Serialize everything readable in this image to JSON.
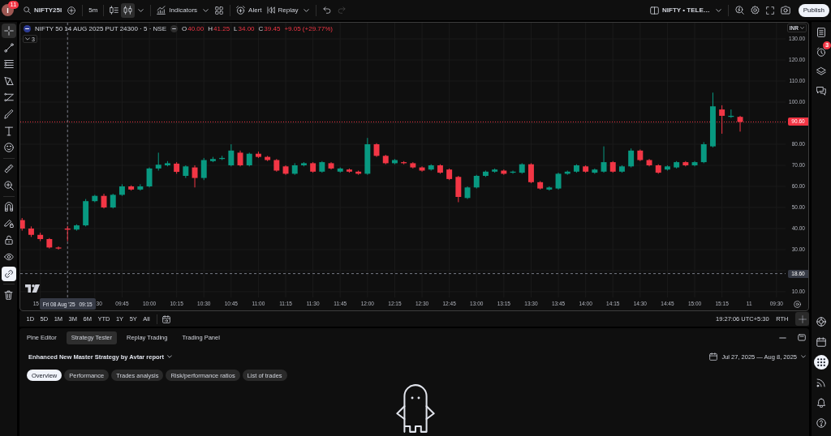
{
  "top_bar": {
    "avatar": {
      "letter": "I",
      "badge": "11"
    },
    "symbol": "NIFTY25I",
    "interval": "5m",
    "chart_styles": [
      {
        "kind": "bars",
        "selected": false
      },
      {
        "kind": "candles",
        "selected": true
      }
    ],
    "indicators": "Indicators",
    "alert": "Alert",
    "replay": "Replay",
    "history": [
      {
        "kind": "undo",
        "disabled": false
      },
      {
        "kind": "redo",
        "disabled": true
      }
    ],
    "layout": "NIFTY • TELE…",
    "publish": "Publish"
  },
  "left_toolbar": {
    "tools": [
      {
        "kind": "crosshair",
        "selected": true
      },
      {
        "kind": "trend-line",
        "selected": false
      },
      {
        "kind": "fib-lines",
        "selected": false
      },
      {
        "kind": "pattern",
        "selected": false
      },
      {
        "kind": "projection",
        "selected": false
      },
      {
        "kind": "brush",
        "selected": false
      },
      {
        "kind": "text",
        "selected": false
      },
      {
        "kind": "emoji",
        "selected": false
      }
    ],
    "measure": [
      {
        "kind": "ruler",
        "selected": false
      },
      {
        "kind": "zoom",
        "selected": false
      }
    ],
    "toggles": [
      {
        "kind": "magnet",
        "on": false
      },
      {
        "kind": "drawing-mode",
        "on": false
      },
      {
        "kind": "lock",
        "on": false
      },
      {
        "kind": "hide",
        "on": false
      },
      {
        "kind": "sync",
        "on": true
      }
    ]
  },
  "chart": {
    "title": "NIFTY 50 14 AUG 2025 PUT 24300 · 5 · NSE",
    "ohlc": [
      {
        "label": "O",
        "value": "40.00"
      },
      {
        "label": "H",
        "value": "41.25"
      },
      {
        "label": "L",
        "value": "34.00"
      },
      {
        "label": "C",
        "value": "39.45"
      }
    ],
    "change": "+9.05 (+29.77%)",
    "falling": true,
    "indicator_count": "3",
    "currency": "INR",
    "crosshair_date": "Fri 08 Aug '25",
    "crosshair_time": "09:15",
    "partial_time_labels": [
      "15",
      "30"
    ],
    "chart_data": {
      "type": "candlestick",
      "grid": true,
      "categories": [
        null,
        null,
        null,
        null,
        null,
        null,
        null,
        null,
        null,
        null,
        null,
        "09:45",
        null,
        null,
        "10:00",
        null,
        null,
        "10:15",
        null,
        null,
        "10:30",
        null,
        null,
        "10:45",
        null,
        null,
        "11:00",
        null,
        null,
        "11:15",
        null,
        null,
        "11:30",
        null,
        null,
        "11:45",
        null,
        null,
        "12:00",
        null,
        null,
        "12:15",
        null,
        null,
        "12:30",
        null,
        null,
        "12:45",
        null,
        null,
        "13:00",
        null,
        null,
        "13:15",
        null,
        null,
        "13:30",
        null,
        null,
        "13:45",
        null,
        null,
        "14:00",
        null,
        null,
        "14:15",
        null,
        null,
        "14:30",
        null,
        null,
        "14:45",
        null,
        null,
        "15:00",
        null,
        null,
        "15:15",
        null,
        null,
        "11",
        null,
        null,
        "09:30"
      ],
      "ohlc": [
        [
          44,
          45,
          39,
          40
        ],
        [
          40,
          41,
          36,
          37
        ],
        [
          37,
          38,
          34,
          35
        ],
        [
          35,
          35.5,
          30.5,
          31
        ],
        [
          31,
          31.5,
          30,
          30.5
        ],
        [
          40,
          41.25,
          34,
          39.45
        ],
        [
          39.5,
          42,
          39,
          41.5
        ],
        [
          41.5,
          54,
          41,
          53
        ],
        [
          53,
          56,
          52.5,
          55.5
        ],
        [
          55.5,
          56.5,
          49.5,
          50
        ],
        [
          50,
          56.5,
          49.5,
          56
        ],
        [
          56,
          61,
          55.5,
          60
        ],
        [
          60,
          60.5,
          58,
          58.5
        ],
        [
          58.5,
          61,
          58,
          60
        ],
        [
          60,
          69,
          59.5,
          68.5
        ],
        [
          68.5,
          76,
          67.5,
          70.3
        ],
        [
          70,
          72,
          69.5,
          71
        ],
        [
          70.8,
          71.5,
          66,
          66.9
        ],
        [
          65,
          70,
          64,
          69.5
        ],
        [
          69,
          70,
          59.5,
          64
        ],
        [
          64,
          73.5,
          63,
          72.5
        ],
        [
          72,
          74,
          71.5,
          73
        ],
        [
          73,
          74.5,
          72.5,
          73.5
        ],
        [
          70,
          80,
          69.5,
          77
        ],
        [
          76,
          77,
          69.5,
          70
        ],
        [
          70,
          76,
          69.5,
          75.5
        ],
        [
          75.5,
          76.5,
          73.5,
          74
        ],
        [
          74,
          74.5,
          72,
          72.5
        ],
        [
          72.5,
          73,
          67,
          67.5
        ],
        [
          69.5,
          70,
          65.5,
          66
        ],
        [
          66,
          71,
          65.5,
          70
        ],
        [
          70,
          71.5,
          69.5,
          71
        ],
        [
          71,
          71.5,
          66.5,
          67
        ],
        [
          67,
          72,
          66.5,
          71.5
        ],
        [
          71,
          71.5,
          68,
          68.5
        ],
        [
          67,
          69,
          66.5,
          68.5
        ],
        [
          68,
          68.5,
          66.5,
          67
        ],
        [
          67,
          67.5,
          65.5,
          66
        ],
        [
          66,
          83,
          65.5,
          80
        ],
        [
          80,
          80.5,
          74,
          74.5
        ],
        [
          74.5,
          75,
          70.5,
          71
        ],
        [
          71,
          73,
          70.5,
          72.5
        ],
        [
          71.5,
          72,
          70.5,
          71
        ],
        [
          71,
          71.5,
          68.5,
          69
        ],
        [
          69,
          69.5,
          67,
          67.5
        ],
        [
          68,
          70.5,
          67.5,
          70
        ],
        [
          70,
          70.5,
          66,
          66.5
        ],
        [
          68,
          68.5,
          63,
          63.5
        ],
        [
          64.5,
          65,
          52.5,
          55
        ],
        [
          54.5,
          60,
          54,
          59.5
        ],
        [
          59.5,
          65.5,
          59,
          65
        ],
        [
          65,
          67.5,
          64.5,
          67
        ],
        [
          67,
          68.5,
          66.5,
          68
        ],
        [
          67.5,
          68,
          65.5,
          66
        ],
        [
          66.5,
          67.5,
          66,
          67
        ],
        [
          66.5,
          71,
          66,
          70.5
        ],
        [
          70.5,
          71,
          61.5,
          62
        ],
        [
          62,
          62.5,
          58.5,
          59
        ],
        [
          58.5,
          60,
          58,
          59.5
        ],
        [
          59,
          66.5,
          58.5,
          66
        ],
        [
          66,
          67.5,
          65.5,
          67
        ],
        [
          67,
          70.5,
          66.5,
          70
        ],
        [
          69.5,
          70,
          66.5,
          67
        ],
        [
          66.5,
          68.5,
          66,
          68
        ],
        [
          67,
          79,
          66.5,
          71.5
        ],
        [
          71.5,
          72,
          66.5,
          67
        ],
        [
          67,
          70,
          66.5,
          69.5
        ],
        [
          69.5,
          78,
          69,
          77
        ],
        [
          77,
          77.5,
          72,
          72.5
        ],
        [
          72.5,
          73,
          69.5,
          70
        ],
        [
          70,
          70.5,
          66,
          66.5
        ],
        [
          68,
          70,
          67.5,
          69.5
        ],
        [
          69,
          72,
          68.5,
          71.5
        ],
        [
          71.5,
          72,
          69.5,
          70
        ],
        [
          70,
          72,
          69.5,
          71.5
        ],
        [
          71.5,
          81,
          71,
          80
        ],
        [
          79,
          104.5,
          78.5,
          98
        ],
        [
          96.5,
          98.5,
          85,
          93.5
        ],
        [
          93,
          96.5,
          92.5,
          93.5
        ],
        [
          93,
          93.5,
          86,
          90.6
        ],
        null,
        null,
        null,
        null
      ],
      "ylim": [
        7.3,
        137.7
      ],
      "yticks": [
        {
          "value": 130,
          "label": "130.00"
        },
        {
          "value": 120,
          "label": "120.00"
        },
        {
          "value": 110,
          "label": "110.00"
        },
        {
          "value": 100,
          "label": "100.00"
        },
        {
          "value": 80,
          "label": "80.00"
        },
        {
          "value": 70,
          "label": "70.00"
        },
        {
          "value": 60,
          "label": "60.00"
        },
        {
          "value": 50,
          "label": "50.00"
        },
        {
          "value": 40,
          "label": "40.00"
        },
        {
          "value": 30,
          "label": "30.00"
        },
        {
          "value": 10,
          "label": "10.00"
        }
      ],
      "ref_lines": [
        {
          "axis": "y",
          "value": 90.6,
          "label": "90.60",
          "color": "#f23645"
        },
        {
          "axis": "y",
          "value": 18.6,
          "label": "18.60",
          "color": "#787b86"
        }
      ]
    }
  },
  "range_bar": {
    "ranges": [
      "1D",
      "5D",
      "1M",
      "3M",
      "6M",
      "YTD",
      "1Y",
      "5Y",
      "All"
    ],
    "clock": "19:27:06 UTC+5:30",
    "session": "RTH"
  },
  "bottom_panel": {
    "tabs": [
      {
        "label": "Pine Editor",
        "selected": false
      },
      {
        "label": "Strategy Tester",
        "selected": true
      },
      {
        "label": "Replay Trading",
        "selected": false
      },
      {
        "label": "Trading Panel",
        "selected": false
      }
    ],
    "strategy": "Enhanced New Master Strategy by Avtar report",
    "date_range": "Jul 27, 2025 — Aug 8, 2025",
    "report_tabs": [
      {
        "label": "Overview",
        "selected": true
      },
      {
        "label": "Performance",
        "selected": false
      },
      {
        "label": "Trades analysis",
        "selected": false
      },
      {
        "label": "Risk/performance ratios",
        "selected": false
      },
      {
        "label": "List of trades",
        "selected": false
      }
    ]
  },
  "right_toolbar": {
    "top": [
      {
        "kind": "watchlist",
        "selected": false
      },
      {
        "kind": "alerts",
        "selected": false,
        "badge": "3"
      },
      {
        "kind": "layers",
        "selected": false
      },
      {
        "kind": "chat",
        "selected": false
      }
    ],
    "bottom": [
      {
        "kind": "target",
        "selected": false
      },
      {
        "kind": "calendar",
        "selected": false
      },
      {
        "kind": "apps",
        "selected": true
      },
      {
        "kind": "feed",
        "selected": false
      },
      {
        "kind": "notifications",
        "selected": false
      },
      {
        "kind": "help",
        "selected": false
      }
    ]
  }
}
